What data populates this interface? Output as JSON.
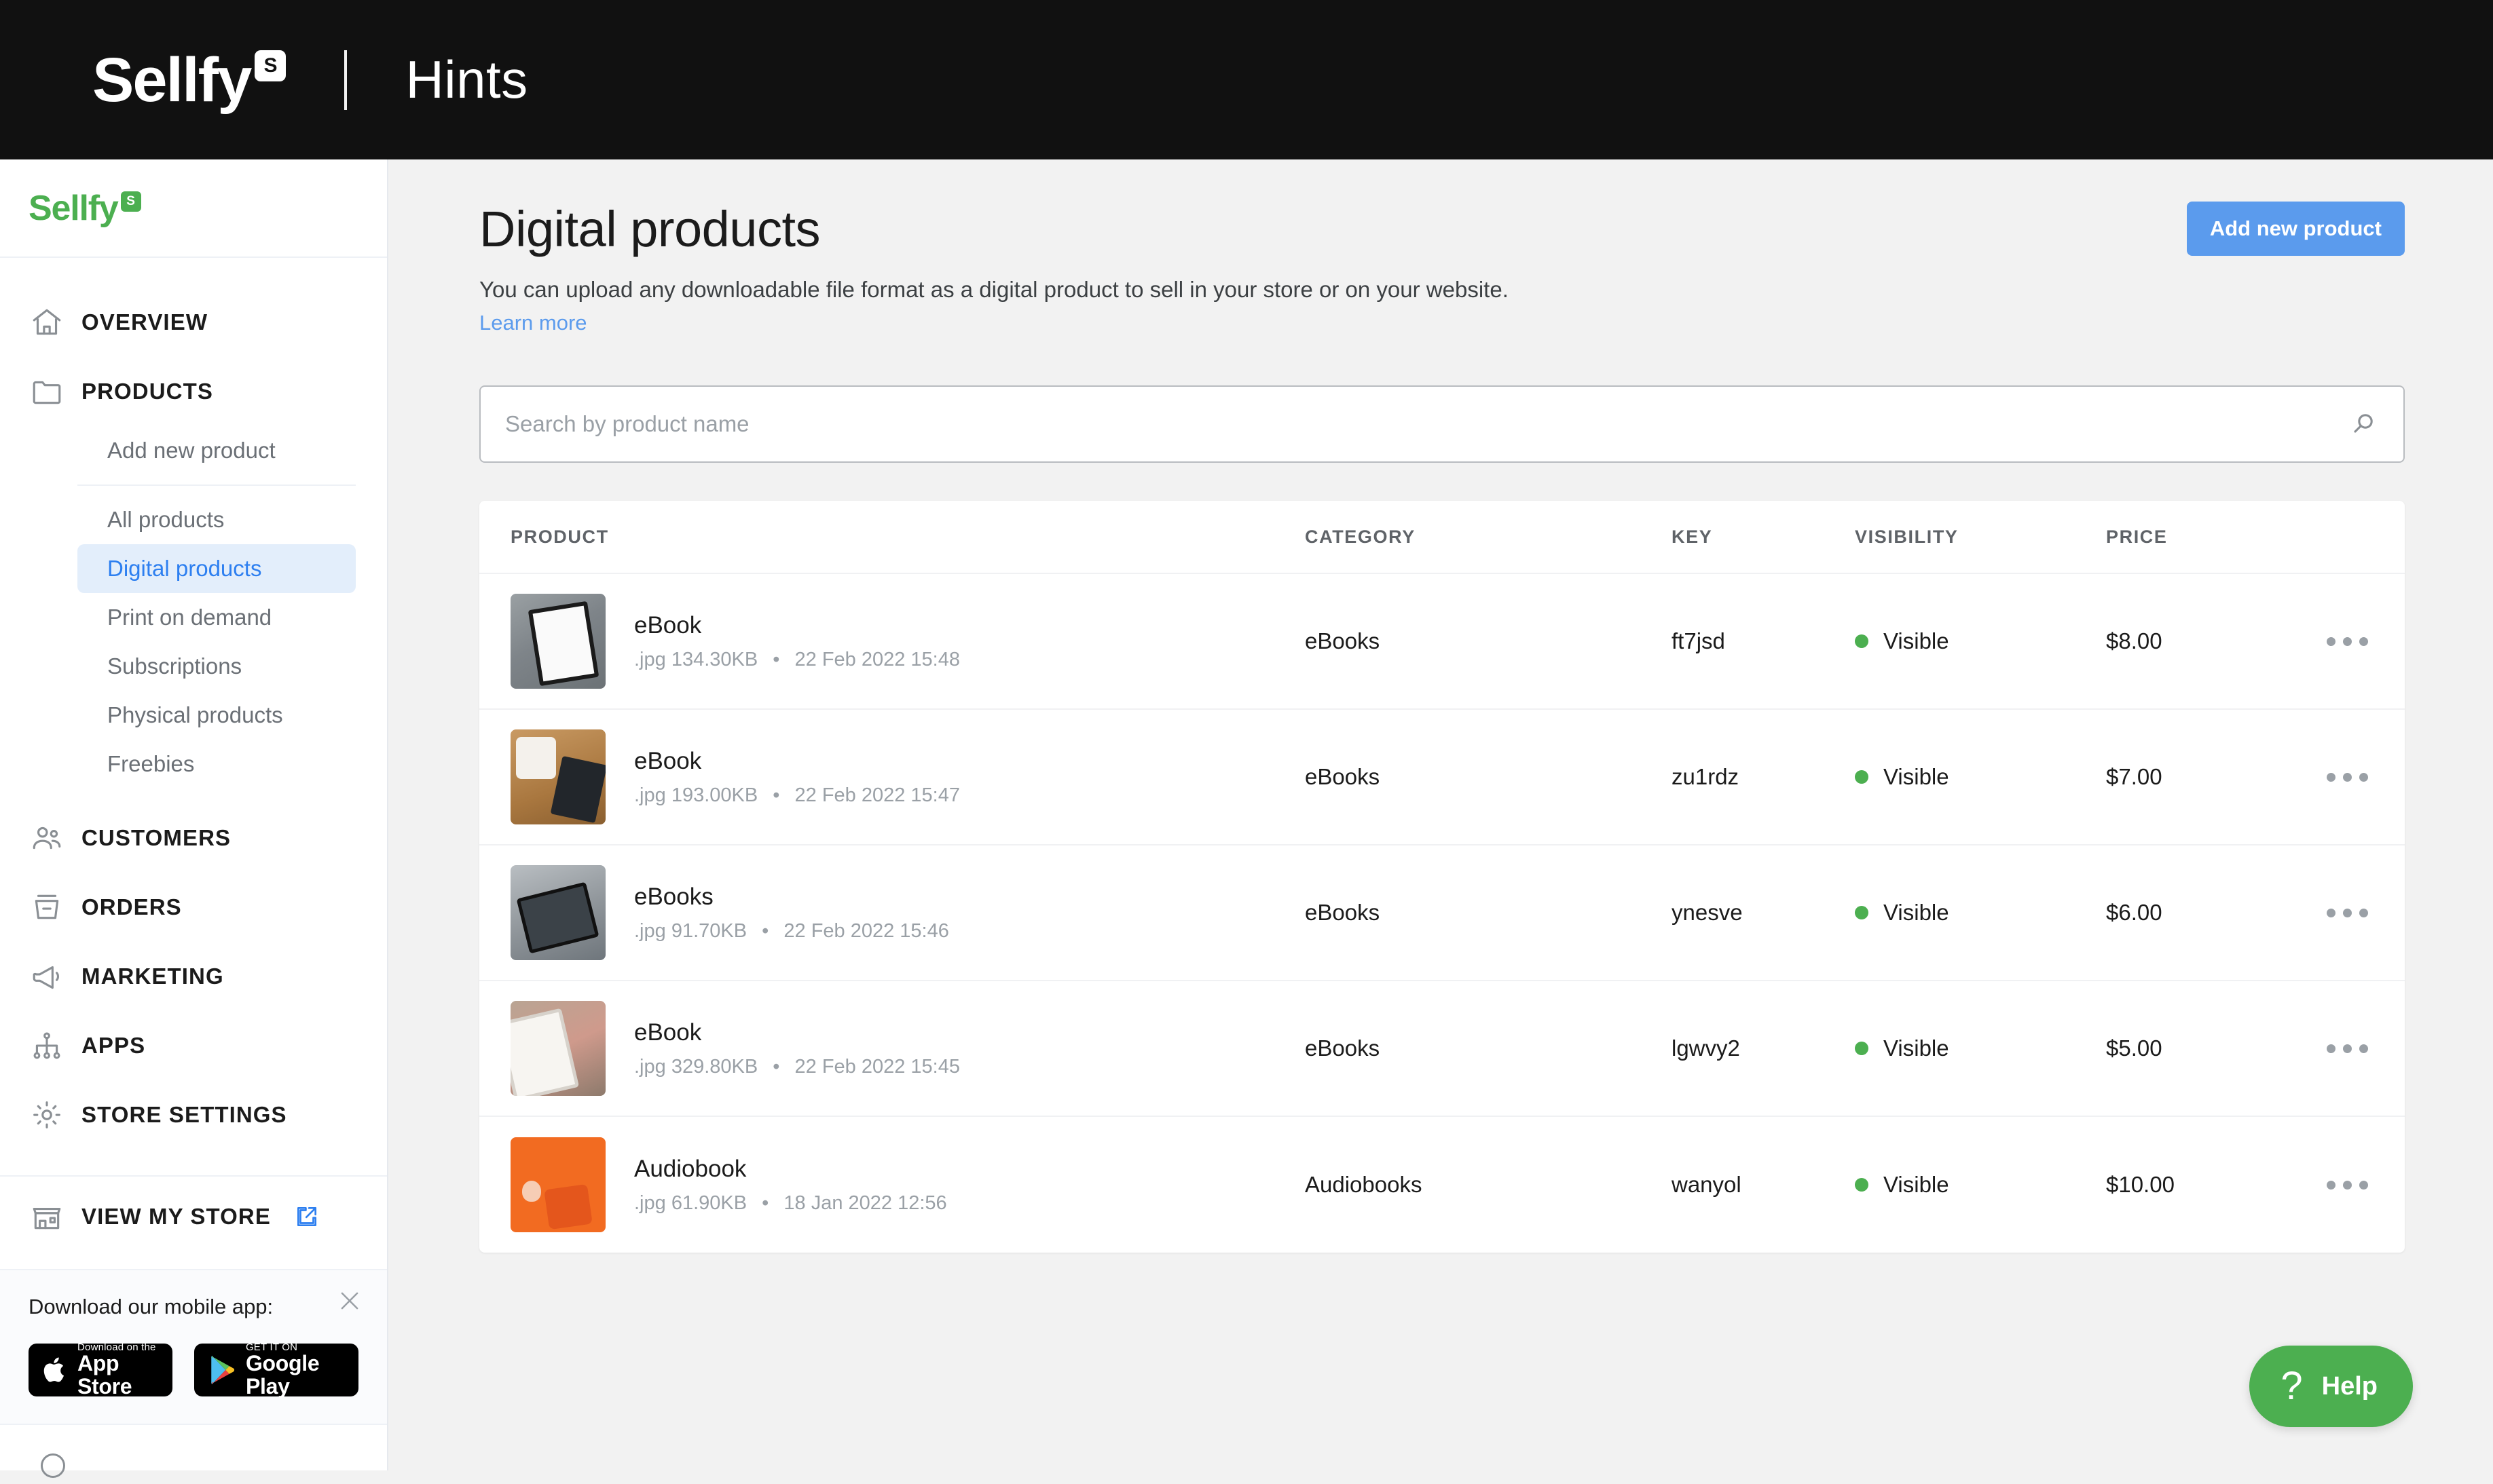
{
  "topbar": {
    "brand": "Sellfy",
    "brand_badge": "S",
    "section_title": "Hints"
  },
  "sidebar": {
    "brand": "Sellfy",
    "brand_badge": "S",
    "nav": [
      {
        "label": "OVERVIEW",
        "icon": "home-icon"
      },
      {
        "label": "PRODUCTS",
        "icon": "folder-icon"
      },
      {
        "label": "CUSTOMERS",
        "icon": "customers-icon"
      },
      {
        "label": "ORDERS",
        "icon": "orders-icon"
      },
      {
        "label": "MARKETING",
        "icon": "megaphone-icon"
      },
      {
        "label": "APPS",
        "icon": "apps-icon"
      },
      {
        "label": "STORE SETTINGS",
        "icon": "gear-icon"
      }
    ],
    "products_subnav": [
      {
        "label": "Add new product",
        "active": false
      },
      {
        "label": "All products",
        "active": false
      },
      {
        "label": "Digital products",
        "active": true
      },
      {
        "label": "Print on demand",
        "active": false
      },
      {
        "label": "Subscriptions",
        "active": false
      },
      {
        "label": "Physical products",
        "active": false
      },
      {
        "label": "Freebies",
        "active": false
      }
    ],
    "view_store": {
      "label": "VIEW MY STORE",
      "icon": "external-link-icon"
    },
    "app_banner": {
      "title": "Download our mobile app:",
      "appstore_small": "Download on the",
      "appstore_big": "App Store",
      "googleplay_small": "GET IT ON",
      "googleplay_big": "Google Play",
      "close_icon": "close-icon"
    }
  },
  "main": {
    "title": "Digital products",
    "description": "You can upload any downloadable file format as a digital product to sell in your store or on your website.",
    "learn_more": "Learn more",
    "add_button": "Add new product",
    "search_placeholder": "Search by product name",
    "search_value": "",
    "columns": [
      "PRODUCT",
      "CATEGORY",
      "KEY",
      "VISIBILITY",
      "PRICE"
    ],
    "rows": [
      {
        "name": "eBook",
        "filetype": ".jpg",
        "size": "134.30KB",
        "date": "22 Feb 2022 15:48",
        "category": "eBooks",
        "key": "ft7jsd",
        "visibility": "Visible",
        "price": "$8.00",
        "thumb": "th1"
      },
      {
        "name": "eBook",
        "filetype": ".jpg",
        "size": "193.00KB",
        "date": "22 Feb 2022 15:47",
        "category": "eBooks",
        "key": "zu1rdz",
        "visibility": "Visible",
        "price": "$7.00",
        "thumb": "th2"
      },
      {
        "name": "eBooks",
        "filetype": ".jpg",
        "size": "91.70KB",
        "date": "22 Feb 2022 15:46",
        "category": "eBooks",
        "key": "ynesve",
        "visibility": "Visible",
        "price": "$6.00",
        "thumb": "th3"
      },
      {
        "name": "eBook",
        "filetype": ".jpg",
        "size": "329.80KB",
        "date": "22 Feb 2022 15:45",
        "category": "eBooks",
        "key": "lgwvy2",
        "visibility": "Visible",
        "price": "$5.00",
        "thumb": "th4"
      },
      {
        "name": "Audiobook",
        "filetype": ".jpg",
        "size": "61.90KB",
        "date": "18 Jan 2022 12:56",
        "category": "Audiobooks",
        "key": "wanyol",
        "visibility": "Visible",
        "price": "$10.00",
        "thumb": "th5"
      }
    ],
    "row_menu_icon": "more-options-icon",
    "help_button": {
      "label": "Help",
      "icon": "question-mark-icon"
    }
  },
  "colors": {
    "topbar_bg": "#111111",
    "brand_green": "#4caf50",
    "accent_blue": "#5b9bed",
    "active_nav_bg": "#e3eefb",
    "active_nav_text": "#2d7ff0",
    "status_green": "#4caf50",
    "page_bg": "#f2f2f2"
  }
}
